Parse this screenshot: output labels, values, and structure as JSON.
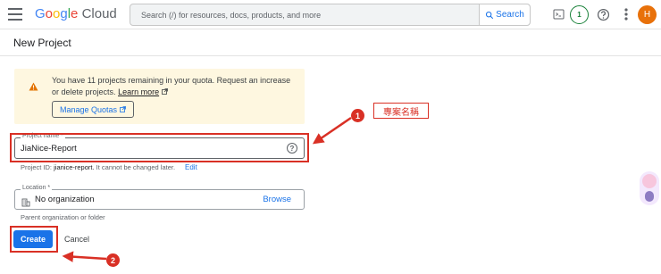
{
  "topbar": {
    "logo_letters": [
      "G",
      "o",
      "o",
      "g",
      "l",
      "e"
    ],
    "logo_product": "Cloud",
    "search_placeholder": "Search (/) for resources, docs, products, and more",
    "search_button": "Search",
    "notifications_count": "1",
    "avatar_initial": "H",
    "icons": [
      "menu-icon",
      "search-icon",
      "cloud-shell-icon",
      "help-icon",
      "more-vert-icon"
    ]
  },
  "page": {
    "title": "New Project"
  },
  "quota": {
    "message": "You have 11 projects remaining in your quota. Request an increase or delete projects.",
    "learn_more": "Learn more",
    "manage_button": "Manage Quotas",
    "icon": "warning-icon"
  },
  "project_name": {
    "label": "Project name *",
    "value": "JiaNice-Report",
    "help_icon": "help-icon"
  },
  "project_id": {
    "prefix": "Project ID:",
    "value": "jianice-report.",
    "suffix": "It cannot be changed later.",
    "edit_label": "Edit"
  },
  "location": {
    "label": "Location *",
    "value": "No organization",
    "browse_label": "Browse",
    "helper": "Parent organization or folder",
    "icon": "organization-icon"
  },
  "actions": {
    "create": "Create",
    "cancel": "Cancel"
  },
  "annotations": {
    "marker_1": "1",
    "marker_2": "2",
    "callout_1": "專案名稱",
    "color": "#d93025"
  },
  "colors": {
    "accent": "#1a73e8",
    "warning_bg": "#fef7e0",
    "notif_green": "#188038",
    "avatar_bg": "#e8710a"
  }
}
